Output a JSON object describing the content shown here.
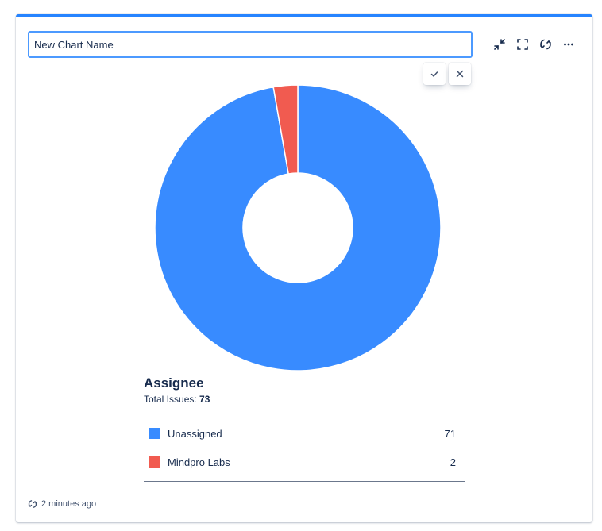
{
  "gadget": {
    "title_value": "New Chart Name",
    "accent_color": "#2684ff"
  },
  "toolbar": {
    "icons": [
      "minimize-icon",
      "fullscreen-icon",
      "refresh-icon",
      "more-icon"
    ]
  },
  "edit_actions": {
    "confirm_icon": "check-icon",
    "cancel_icon": "close-icon"
  },
  "chart_data": {
    "type": "pie",
    "title": "Assignee",
    "total_label": "Total Issues:",
    "total": "73",
    "hole": true,
    "categories": [
      "Unassigned",
      "Mindpro Labs"
    ],
    "values": [
      71,
      2
    ],
    "colors": [
      "#388bff",
      "#f15b50"
    ]
  },
  "legend": {
    "items": [
      {
        "label": "Unassigned",
        "count": "71",
        "color": "#388bff"
      },
      {
        "label": "Mindpro Labs",
        "count": "2",
        "color": "#f15b50"
      }
    ]
  },
  "footer": {
    "updated": "2 minutes ago"
  }
}
